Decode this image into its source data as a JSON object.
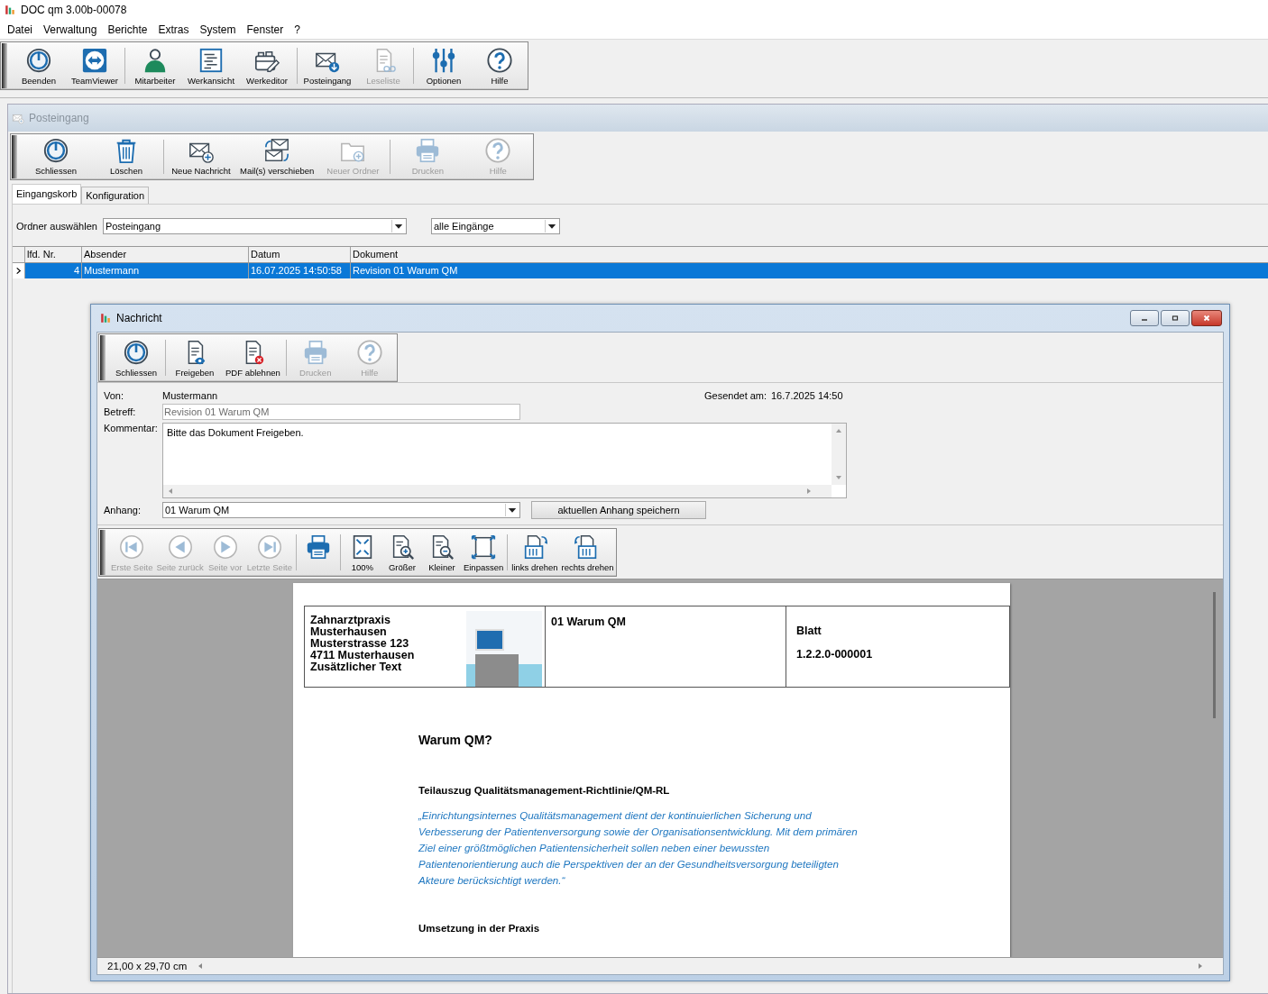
{
  "window": {
    "title": "DOC qm 3.00b-00078"
  },
  "menu": [
    "Datei",
    "Verwaltung",
    "Berichte",
    "Extras",
    "System",
    "Fenster",
    "?"
  ],
  "main_toolbar": [
    [
      {
        "label": "Beenden",
        "kind": "power",
        "disabled": false
      },
      {
        "label": "TeamViewer",
        "kind": "remote",
        "disabled": false
      }
    ],
    [
      {
        "label": "Mitarbeiter",
        "kind": "person",
        "disabled": false
      },
      {
        "label": "Werkansicht",
        "kind": "doclines",
        "disabled": false
      },
      {
        "label": "Werkeditor",
        "kind": "editor",
        "disabled": false
      }
    ],
    [
      {
        "label": "Posteingang",
        "kind": "inbox",
        "disabled": false
      },
      {
        "label": "Leseliste",
        "kind": "readlist",
        "disabled": true
      }
    ],
    [
      {
        "label": "Optionen",
        "kind": "sliders",
        "disabled": false
      },
      {
        "label": "Hilfe",
        "kind": "help",
        "disabled": false
      }
    ]
  ],
  "inbox": {
    "title": "Posteingang",
    "toolbar": [
      [
        {
          "label": "Schliessen",
          "kind": "power",
          "disabled": false
        },
        {
          "label": "Löschen",
          "kind": "trash",
          "disabled": false
        }
      ],
      [
        {
          "label": "Neue Nachricht",
          "kind": "newmail",
          "disabled": false
        },
        {
          "label": "Mail(s) verschieben",
          "kind": "movemail",
          "disabled": false
        },
        {
          "label": "Neuer Ordner",
          "kind": "newfolder",
          "disabled": true
        }
      ],
      [
        {
          "label": "Drucken",
          "kind": "print",
          "disabled": true
        },
        {
          "label": "Hilfe",
          "kind": "help",
          "disabled": true
        }
      ]
    ],
    "tabs": [
      {
        "label": "Eingangskorb",
        "selected": true
      },
      {
        "label": "Konfiguration",
        "selected": false
      }
    ],
    "folder_label": "Ordner auswählen",
    "folder": "Posteingang",
    "filter": "alle Eingänge",
    "table": {
      "columns": [
        "lfd. Nr.",
        "Absender",
        "Datum",
        "Dokument"
      ],
      "rows": [
        {
          "cells": [
            "4",
            "Mustermann",
            "16.07.2025 14:50:58",
            "Revision 01 Warum QM"
          ],
          "selected": true
        }
      ]
    }
  },
  "message": {
    "title": "Nachricht",
    "toolbar": [
      [
        {
          "label": "Schliessen",
          "kind": "power",
          "disabled": false
        }
      ],
      [
        {
          "label": "Freigeben",
          "kind": "approve",
          "disabled": false
        },
        {
          "label": "PDF ablehnen",
          "kind": "reject",
          "disabled": false
        }
      ],
      [
        {
          "label": "Drucken",
          "kind": "print",
          "disabled": true
        },
        {
          "label": "Hilfe",
          "kind": "help",
          "disabled": true
        }
      ]
    ],
    "from_label": "Von:",
    "from": "Mustermann",
    "sent_label": "Gesendet am:",
    "sent": "16.7.2025 14:50",
    "subject_label": "Betreff:",
    "subject": "Revision 01 Warum QM",
    "comment_label": "Kommentar:",
    "comment": "Bitte das Dokument Freigeben.",
    "attachment_label": "Anhang:",
    "attachment": "01 Warum QM",
    "save_button": "aktuellen Anhang speichern",
    "viewer_toolbar": [
      [
        {
          "label": "Erste Seite",
          "kind": "first",
          "disabled": true
        },
        {
          "label": "Seite zurück",
          "kind": "prev",
          "disabled": true
        },
        {
          "label": "Seite vor",
          "kind": "next",
          "disabled": true
        },
        {
          "label": "Letzte Seite",
          "kind": "last",
          "disabled": true
        }
      ],
      [
        {
          "kind": "print",
          "disabled": false
        }
      ],
      [
        {
          "label": "100%",
          "kind": "fit100",
          "disabled": false
        },
        {
          "label": "Größer",
          "kind": "zoomin",
          "disabled": false
        },
        {
          "label": "Kleiner",
          "kind": "zoomout",
          "disabled": false
        },
        {
          "label": "Einpassen",
          "kind": "fitpage",
          "disabled": false
        }
      ],
      [
        {
          "label": "links drehen",
          "kind": "rotl",
          "disabled": false
        },
        {
          "label": "rechts drehen",
          "kind": "rotr",
          "disabled": false
        }
      ]
    ],
    "document": {
      "org_lines": [
        "Zahnarztpraxis",
        "Musterhausen",
        "Musterstrasse 123",
        "4711 Musterhausen",
        "Zusätzlicher Text"
      ],
      "doc_title": "01 Warum QM",
      "sheet_label": "Blatt",
      "sheet_number": "1.2.2.0-000001",
      "heading": "Warum QM?",
      "subheading": "Teilauszug Qualitätsmanagement-Richtlinie/QM-RL",
      "quote": "„Einrichtungsinternes Qualitätsmanagement dient der kontinuierlichen Sicherung und Verbesserung der Patientenversorgung sowie der Organisationsentwicklung. Mit dem primären Ziel einer größtmöglichen Patientensicherheit sollen neben einer bewussten Patientenorientierung auch die Perspektiven der an der Gesundheitsversorgung beteiligten Akteure berücksichtigt werden.“",
      "section": "Umsetzung in der Praxis"
    },
    "page_size": "21,00 x 29,70 cm"
  }
}
